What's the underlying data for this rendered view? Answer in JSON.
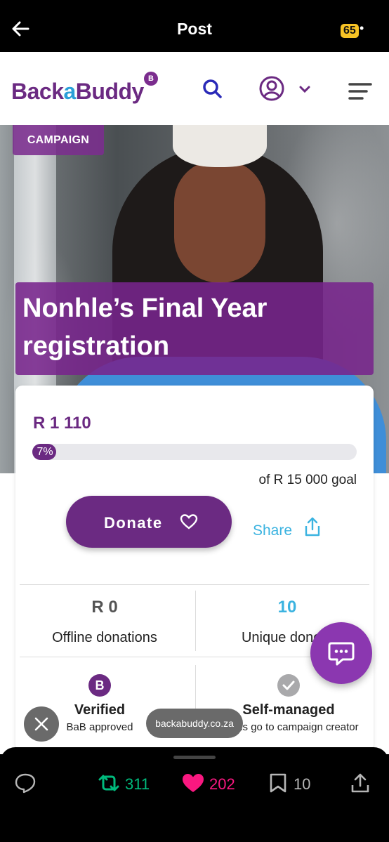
{
  "topbar": {
    "title": "Post",
    "badge": "65"
  },
  "site": {
    "logo_pre": "Back",
    "logo_a": "a",
    "logo_post": "Buddy",
    "logo_badge": "B"
  },
  "campaign": {
    "tag": "CAMPAIGN",
    "title_line1": "Nonhle’s Final Year",
    "title_line2": "registration",
    "raised": "R 1 110",
    "progress_label": "7%",
    "progress_fraction": 0.07,
    "goal": "of R 15 000 goal",
    "donate_label": "Donate",
    "share_label": "Share"
  },
  "stats": {
    "offline_value": "R 0",
    "offline_label": "Offline donations",
    "unique_value": "10",
    "unique_label": "Unique donors"
  },
  "badges": {
    "verified_title": "Verified",
    "verified_sub": "BaB approved",
    "verified_icon_letter": "B",
    "selfmanaged_title": "Self-managed",
    "selfmanaged_sub": "Funds go to campaign creator"
  },
  "browser": {
    "url": "backabuddy.co.za"
  },
  "actions": {
    "retweets": "311",
    "likes": "202",
    "bookmarks": "10"
  },
  "colors": {
    "brand": "#6b2a82",
    "accent": "#3bb3e0",
    "retweet": "#00ba7c",
    "like": "#f91880"
  }
}
